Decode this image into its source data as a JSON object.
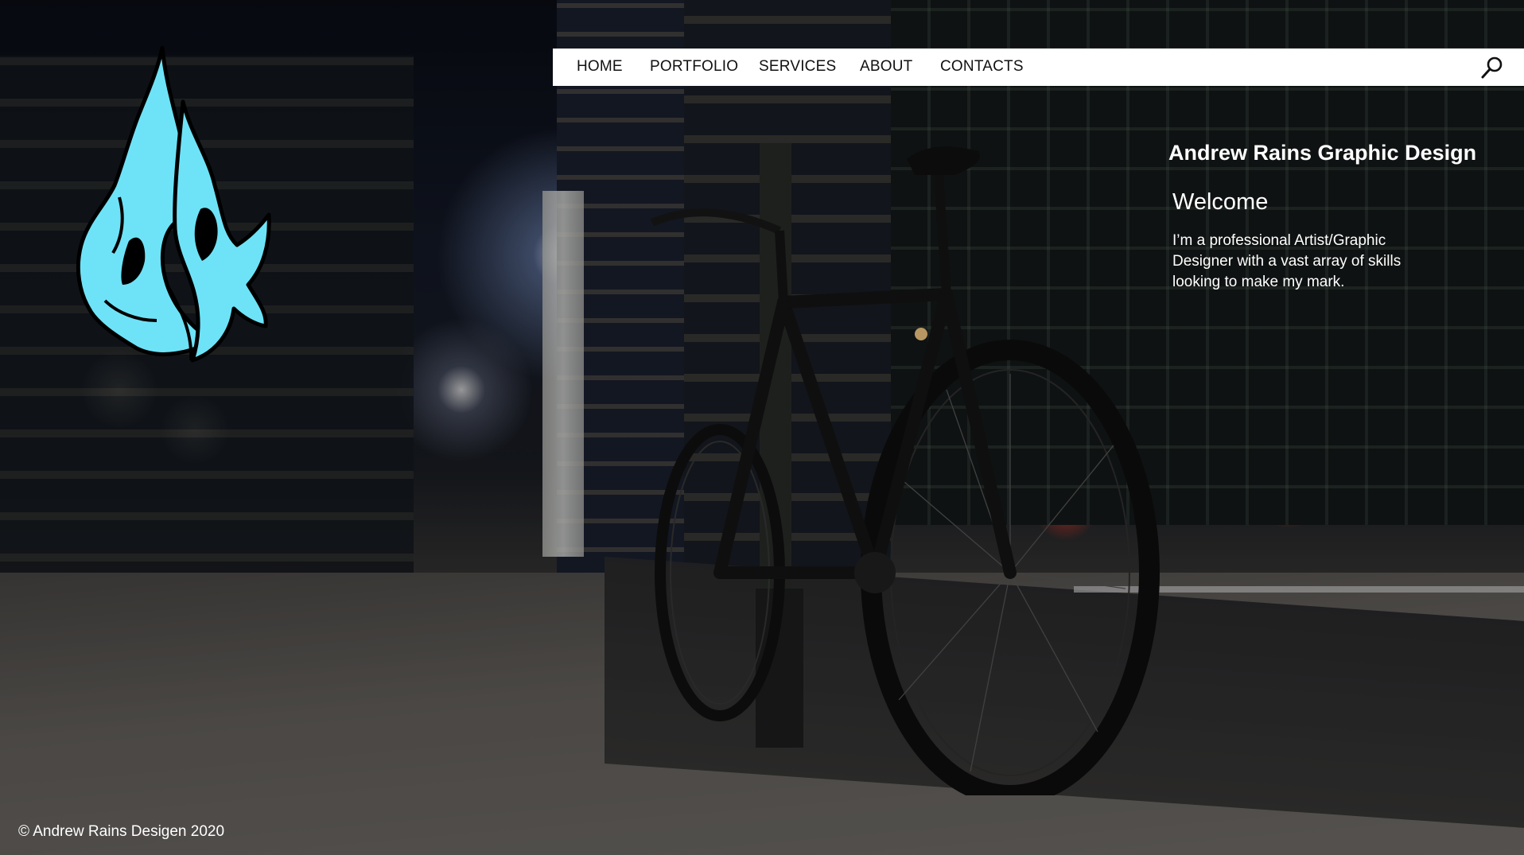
{
  "nav": {
    "items": [
      {
        "label": "HOME"
      },
      {
        "label": "PORTFOLIO"
      },
      {
        "label": "SERVICES"
      },
      {
        "label": "ABOUT"
      },
      {
        "label": "CONTACTS"
      }
    ],
    "search_icon": "search-icon"
  },
  "hero": {
    "title": "Andrew Rains Graphic Design",
    "subtitle": "Welcome",
    "body": "I’m a professional Artist/Graphic Designer with a vast array of skills looking to make my mark."
  },
  "footer": {
    "copyright": "© Andrew Rains Desigen 2020"
  },
  "colors": {
    "logo_fill": "#6ee3f7",
    "logo_outline": "#000000",
    "nav_bg": "#ffffff",
    "text_light": "#ffffff"
  },
  "background": {
    "description_icon": "night-city-bicycle-photo"
  }
}
